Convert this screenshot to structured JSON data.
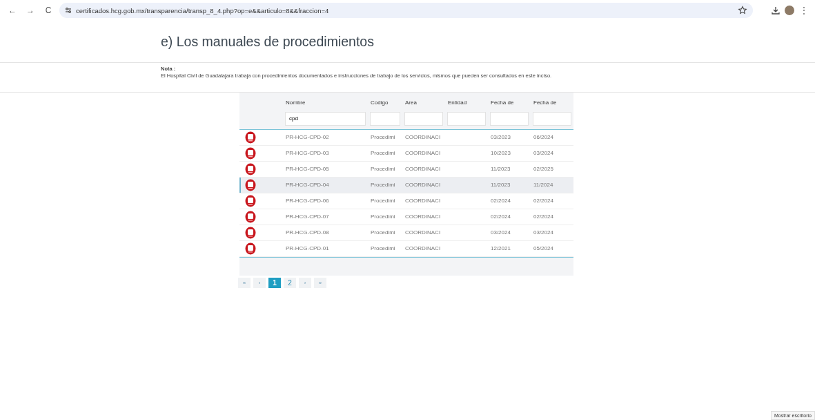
{
  "browser": {
    "url": "certificados.hcg.gob.mx/transparencia/transp_8_4.php?op=e&&articulo=8&&fraccion=4",
    "nav": [
      "←",
      "→",
      "C"
    ],
    "menu": "⋮"
  },
  "page": {
    "title": "e) Los manuales de procedimientos",
    "note_label": "Nota :",
    "note": "El Hospital Civil de Guadalajara trabaja con procedimientos documentados e instrucciones de trabajo de los servicios, mismos que pueden ser consultados en este inciso."
  },
  "table": {
    "columns": [
      {
        "label": "Nombre",
        "filter": "cpd"
      },
      {
        "label": "Codigo"
      },
      {
        "label": "Area"
      },
      {
        "label": "Entidad"
      },
      {
        "label": "Fecha de"
      },
      {
        "label": "Fecha de"
      }
    ],
    "rows": [
      {
        "selected": false,
        "cells": [
          "PR-HCG-CPD-02",
          "Procedimi",
          "COORDINACI",
          "",
          "03/2023",
          "06/2024"
        ]
      },
      {
        "selected": false,
        "cells": [
          "PR-HCG-CPD-03",
          "Procedimi",
          "COORDINACI",
          "",
          "10/2023",
          "03/2024"
        ]
      },
      {
        "selected": false,
        "cells": [
          "PR-HCG-CPD-05",
          "Procedimi",
          "COORDINACI",
          "",
          "11/2023",
          "02/2025"
        ]
      },
      {
        "selected": true,
        "cells": [
          "PR-HCG-CPD-04",
          "Procedimi",
          "COORDINACI",
          "",
          "11/2023",
          "11/2024"
        ]
      },
      {
        "selected": false,
        "cells": [
          "PR-HCG-CPD-06",
          "Procedimi",
          "COORDINACI",
          "",
          "02/2024",
          "02/2024"
        ]
      },
      {
        "selected": false,
        "cells": [
          "PR-HCG-CPD-07",
          "Procedimi",
          "COORDINACI",
          "",
          "02/2024",
          "02/2024"
        ]
      },
      {
        "selected": false,
        "cells": [
          "PR-HCG-CPD-08",
          "Procedimi",
          "COORDINACI",
          "",
          "03/2024",
          "03/2024"
        ]
      },
      {
        "selected": false,
        "cells": [
          "PR-HCG-CPD-01",
          "Procedimi",
          "COORDINACI",
          "",
          "12/2021",
          "05/2024"
        ]
      }
    ]
  },
  "pager": [
    {
      "label": "«",
      "selected": false
    },
    {
      "label": "‹",
      "selected": false
    },
    {
      "label": "1",
      "selected": true
    },
    {
      "label": "2",
      "selected": false
    },
    {
      "label": "›",
      "selected": false
    },
    {
      "label": "»",
      "selected": false
    }
  ],
  "tooltip": "Mostrar escritorio"
}
